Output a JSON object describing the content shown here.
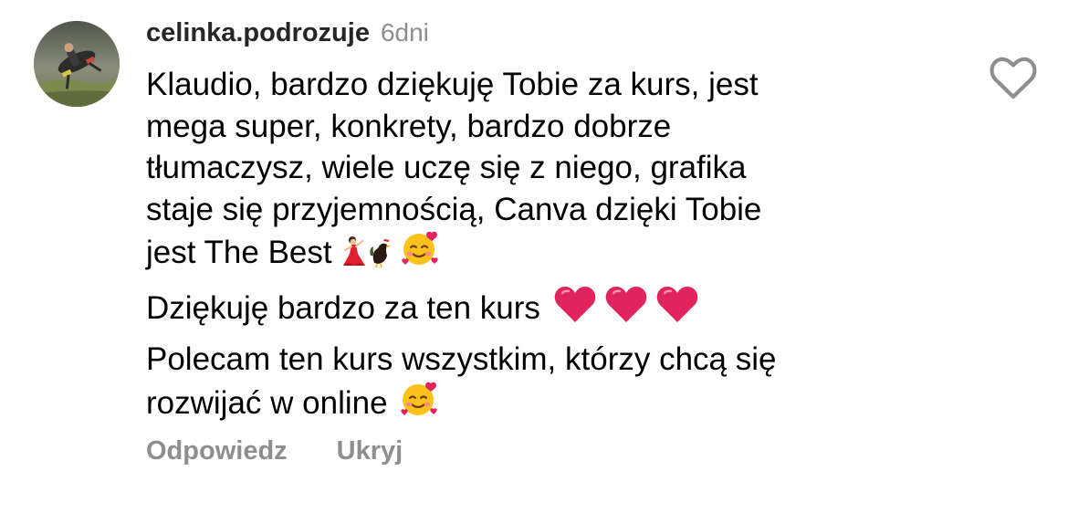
{
  "comment": {
    "username": "celinka.podrozuje",
    "timestamp": "6dni",
    "paragraphs": [
      {
        "lines": [
          "Klaudio, bardzo dziękuję Tobie za kurs, jest",
          "mega super, konkrety, bardzo dobrze",
          "tłumaczysz, wiele uczę się z niego, grafika",
          "staje się przyjemnością, Canva dzięki Tobie",
          "jest The Best"
        ],
        "trailing_emojis": [
          "dancer-emoji",
          "rooster-emoji",
          "smiling-face-with-hearts-emoji"
        ]
      },
      {
        "lines": [
          "Dziękuję bardzo za ten kurs"
        ],
        "trailing_emojis": [
          "red-heart-emoji",
          "red-heart-emoji",
          "red-heart-emoji"
        ]
      },
      {
        "lines": [
          "Polecam ten kurs wszystkim, którzy chcą się",
          "rozwijać w online"
        ],
        "trailing_emojis": [
          "smiling-face-with-hearts-emoji"
        ]
      }
    ],
    "actions": {
      "reply_label": "Odpowiedz",
      "hide_label": "Ukryj"
    },
    "like_icon": "heart-outline-icon"
  },
  "colors": {
    "username": "#262626",
    "secondary_text": "#8e8e8e",
    "body_text": "#000000",
    "heart_red": "#e0245e"
  }
}
